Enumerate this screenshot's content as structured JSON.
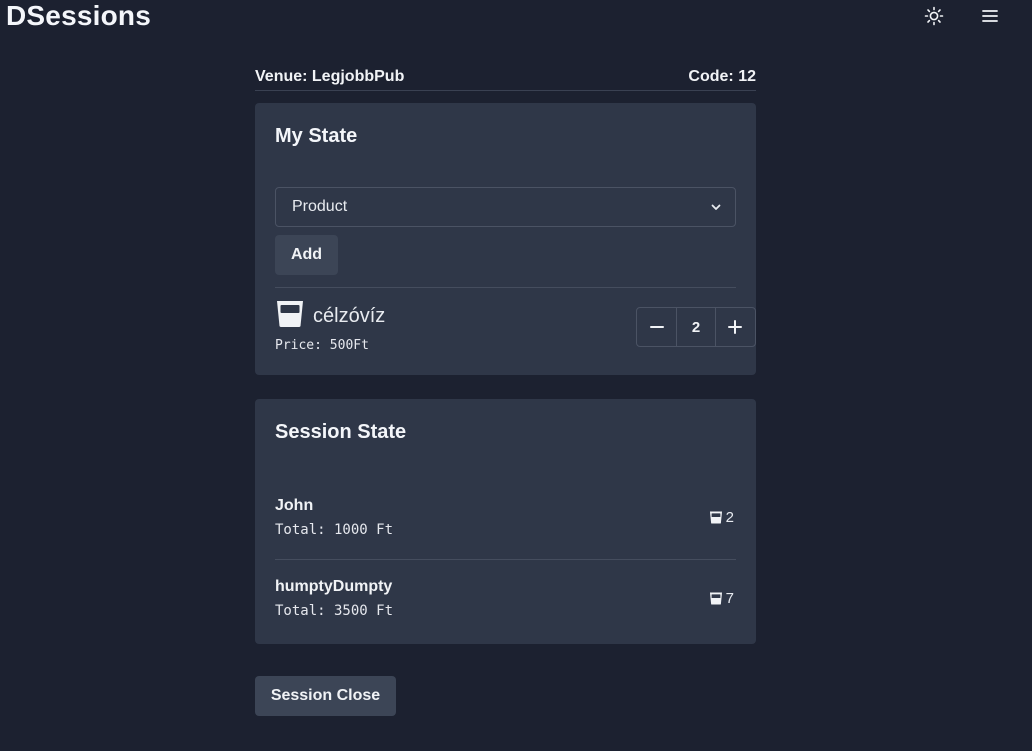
{
  "header": {
    "brand": "DSessions",
    "theme_icon": "sun-icon",
    "menu_icon": "hamburger-menu-icon"
  },
  "venue": {
    "label": "Venue: LegjobbPub",
    "code": "Code: 12"
  },
  "my_state": {
    "title": "My State",
    "product_select": {
      "selected": "Product"
    },
    "add_label": "Add",
    "product": {
      "icon": "glass-icon",
      "name": "célzóvíz",
      "price": "Price: 500Ft",
      "quantity": "2"
    }
  },
  "session_state": {
    "title": "Session State",
    "users": [
      {
        "name": "John",
        "total": "Total: 1000 Ft",
        "count": "2",
        "icon": "glass-icon"
      },
      {
        "name": "humptyDumpty",
        "total": "Total: 3500 Ft",
        "count": "7",
        "icon": "glass-icon"
      }
    ]
  },
  "close_label": "Session Close",
  "colors": {
    "background": "#1c2130",
    "card": "#2f3748",
    "button": "#3c4556",
    "text": "#f1f3f6"
  }
}
